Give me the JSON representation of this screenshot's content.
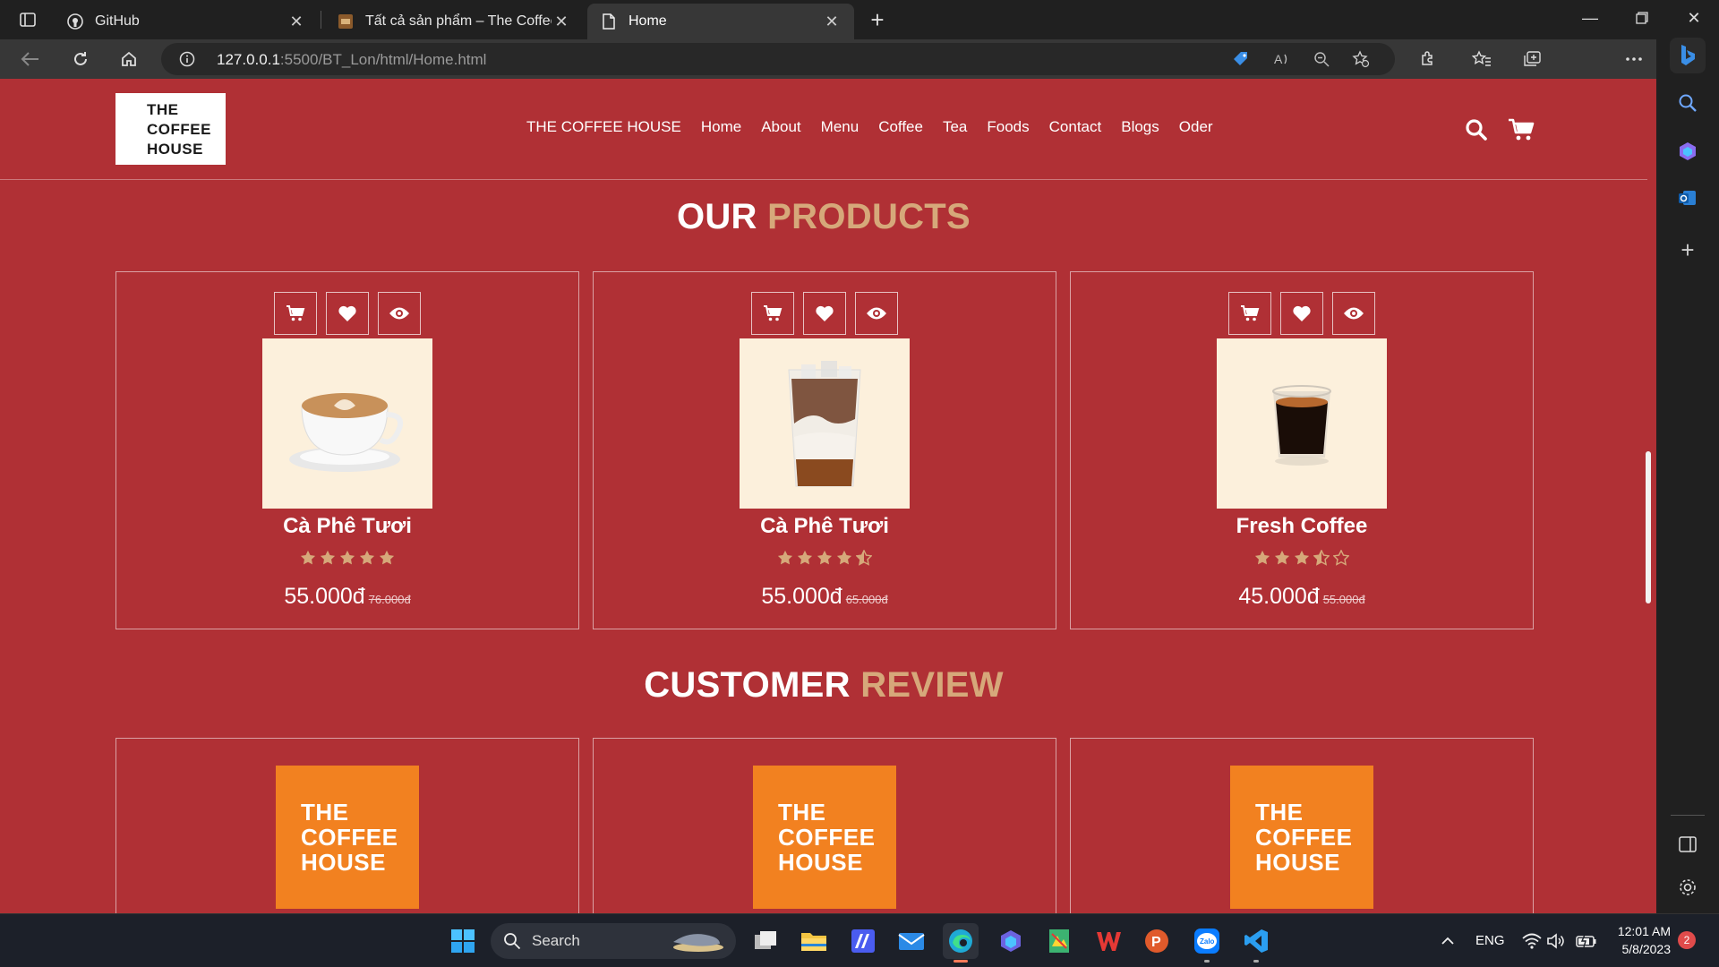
{
  "browser": {
    "tabs": [
      {
        "title": "GitHub",
        "favicon": "github-icon"
      },
      {
        "title": "Tất cả sản phẩm – The Coffee Ho",
        "favicon": "coffee-favicon"
      },
      {
        "title": "Home",
        "favicon": "page-icon",
        "active": true
      }
    ],
    "url_host": "127.0.0.1",
    "url_path": ":5500/BT_Lon/html/Home.html"
  },
  "site": {
    "logo_lines": [
      "THE",
      "COFFEE",
      "HOUSE"
    ],
    "nav": [
      "THE COFFEE HOUSE",
      "Home",
      "About",
      "Menu",
      "Coffee",
      "Tea",
      "Foods",
      "Contact",
      "Blogs",
      "Oder"
    ]
  },
  "products_section": {
    "title_white": "OUR",
    "title_accent": "PRODUCTS"
  },
  "products": [
    {
      "name": "Cà Phê Tươi",
      "price": "55.000đ",
      "old_price": "76.000đ",
      "rating": 5,
      "image": "latte-cup"
    },
    {
      "name": "Cà Phê Tươi",
      "price": "55.000đ",
      "old_price": "65.000đ",
      "rating": 4.5,
      "image": "iced-latte"
    },
    {
      "name": "Fresh Coffee",
      "price": "45.000đ",
      "old_price": "55.000đ",
      "rating": 3.5,
      "image": "espresso-shot"
    }
  ],
  "review_section": {
    "title_white": "CUSTOMER",
    "title_accent": "REVIEW"
  },
  "review_logo_lines": [
    "THE",
    "COFFEE",
    "HOUSE"
  ],
  "taskbar": {
    "search": "Search",
    "lang": "ENG",
    "time": "12:01 AM",
    "date": "5/8/2023",
    "badge": "2"
  },
  "colors": {
    "page_bg": "#b03035",
    "accent": "#d6a87a",
    "review_logo": "#f28120",
    "product_bg": "#fcf0dc"
  }
}
